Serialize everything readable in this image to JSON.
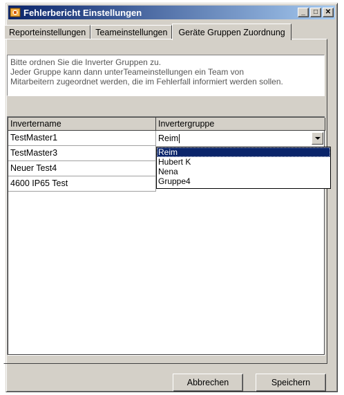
{
  "window": {
    "title": "Fehlerbericht Einstellungen",
    "minimize_label": "_",
    "maximize_label": "□",
    "close_label": "✕"
  },
  "tabs": [
    {
      "label": "Reporteinstellungen",
      "active": false
    },
    {
      "label": "Teameinstellungen",
      "active": false
    },
    {
      "label": "Geräte Gruppen Zuordnung",
      "active": true
    }
  ],
  "info": {
    "lines": [
      "Bitte ordnen Sie die Inverter Gruppen zu.",
      "Jeder Gruppe  kann dann unterTeameinstellungen ein Team von",
      "Mitarbeitern zugeordnet werden, die im Fehlerfall informiert werden sollen."
    ]
  },
  "grid": {
    "columns": [
      "Invertername",
      "Invertergruppe"
    ],
    "rows": [
      {
        "name": "TestMaster1",
        "group": "Reim"
      },
      {
        "name": "TestMaster3",
        "group": ""
      },
      {
        "name": "Neuer Test4",
        "group": ""
      },
      {
        "name": "4600 IP65 Test",
        "group": ""
      }
    ],
    "editing_value": "Reim",
    "dropdown_options": [
      "Reim",
      "Hubert K",
      "Nena",
      "Gruppe4"
    ],
    "selected_option": "Reim"
  },
  "buttons": {
    "cancel": "Abbrechen",
    "save": "Speichern"
  },
  "colors": {
    "titlebar_start": "#0a246a",
    "titlebar_end": "#a6caf0",
    "selection": "#0a246a",
    "face": "#d4d0c8"
  }
}
